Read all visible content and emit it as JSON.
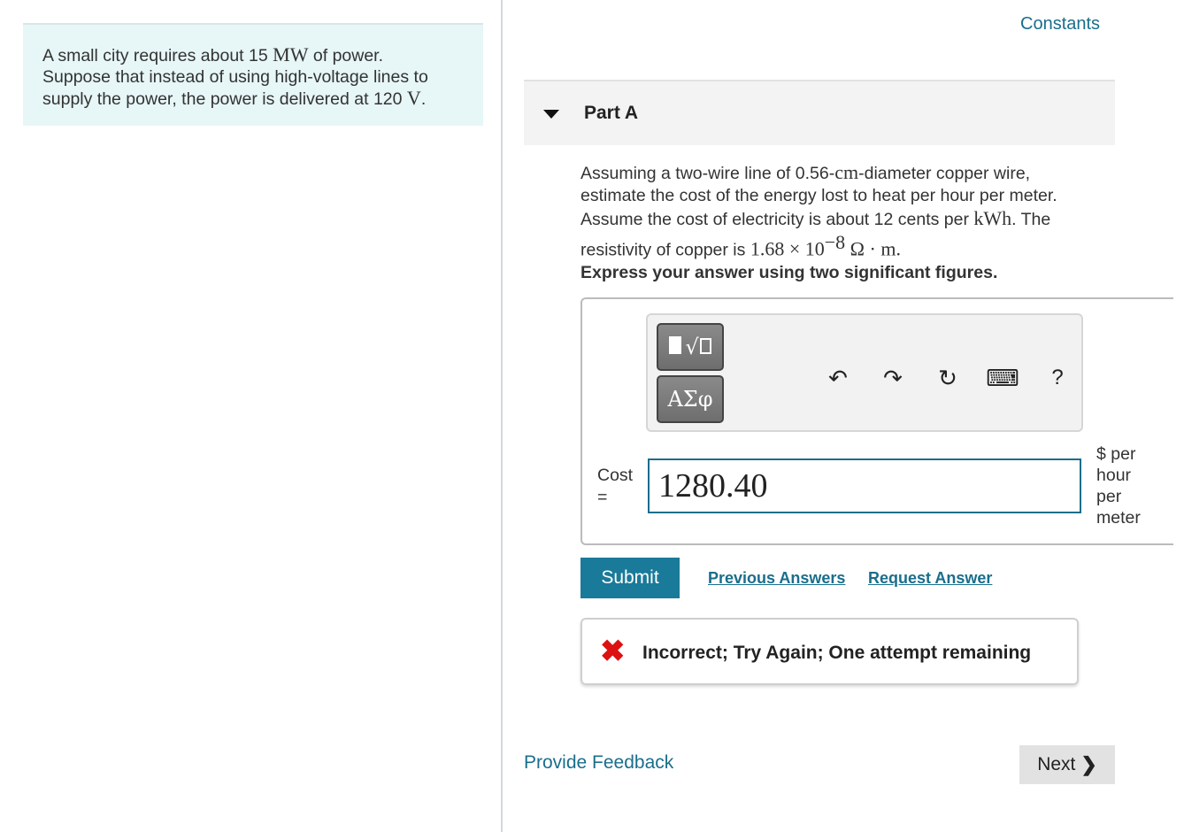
{
  "intro": {
    "line1_pre": "A small city requires about 15 ",
    "line1_unit": "MW",
    "line1_post": " of power.",
    "line2": "Suppose that instead of using high-voltage lines to",
    "line3_pre": "supply the power, the power is delivered at 120 ",
    "line3_unit": "V",
    "line3_post": "."
  },
  "header": {
    "constants_link": "Constants"
  },
  "part": {
    "title": "Part A"
  },
  "question": {
    "l1_pre": "Assuming a two-wire line of 0.56-",
    "l1_unit": "cm",
    "l1_post": "-diameter copper wire,",
    "l2": "estimate the cost of the energy lost to heat per hour per meter.",
    "l3_pre": "Assume the cost of electricity is about 12 cents per ",
    "l3_unit": "kWh",
    "l3_post": ". The",
    "l4_pre": "resistivity of copper is ",
    "l4_math": "1.68 × 10",
    "l4_exp": "−8",
    "l4_unit": " Ω · m",
    "l4_post": ".",
    "instruction": "Express your answer using two significant figures."
  },
  "toolbar": {
    "templates_icon": "template-radical-icon",
    "greek_label": "ΑΣφ",
    "undo_icon": "↶",
    "redo_icon": "↷",
    "reset_icon": "↻",
    "keyboard_icon": "⌨",
    "help_label": "?"
  },
  "answer": {
    "label_line1": "Cost",
    "label_line2": "=",
    "value": "1280.40",
    "unit_lines": [
      "$ per",
      "hour",
      "per",
      "meter"
    ]
  },
  "actions": {
    "submit_label": "Submit",
    "previous_answers": "Previous Answers",
    "request_answer": "Request Answer"
  },
  "feedback": {
    "icon": "✖",
    "text": "Incorrect; Try Again; One attempt remaining",
    "icon_color": "#dd1111"
  },
  "footer": {
    "provide_feedback": "Provide Feedback",
    "next_label": "Next",
    "next_icon": "❯"
  },
  "colors": {
    "accent": "#1a7a99",
    "intro_bg": "#e7f6f7"
  }
}
